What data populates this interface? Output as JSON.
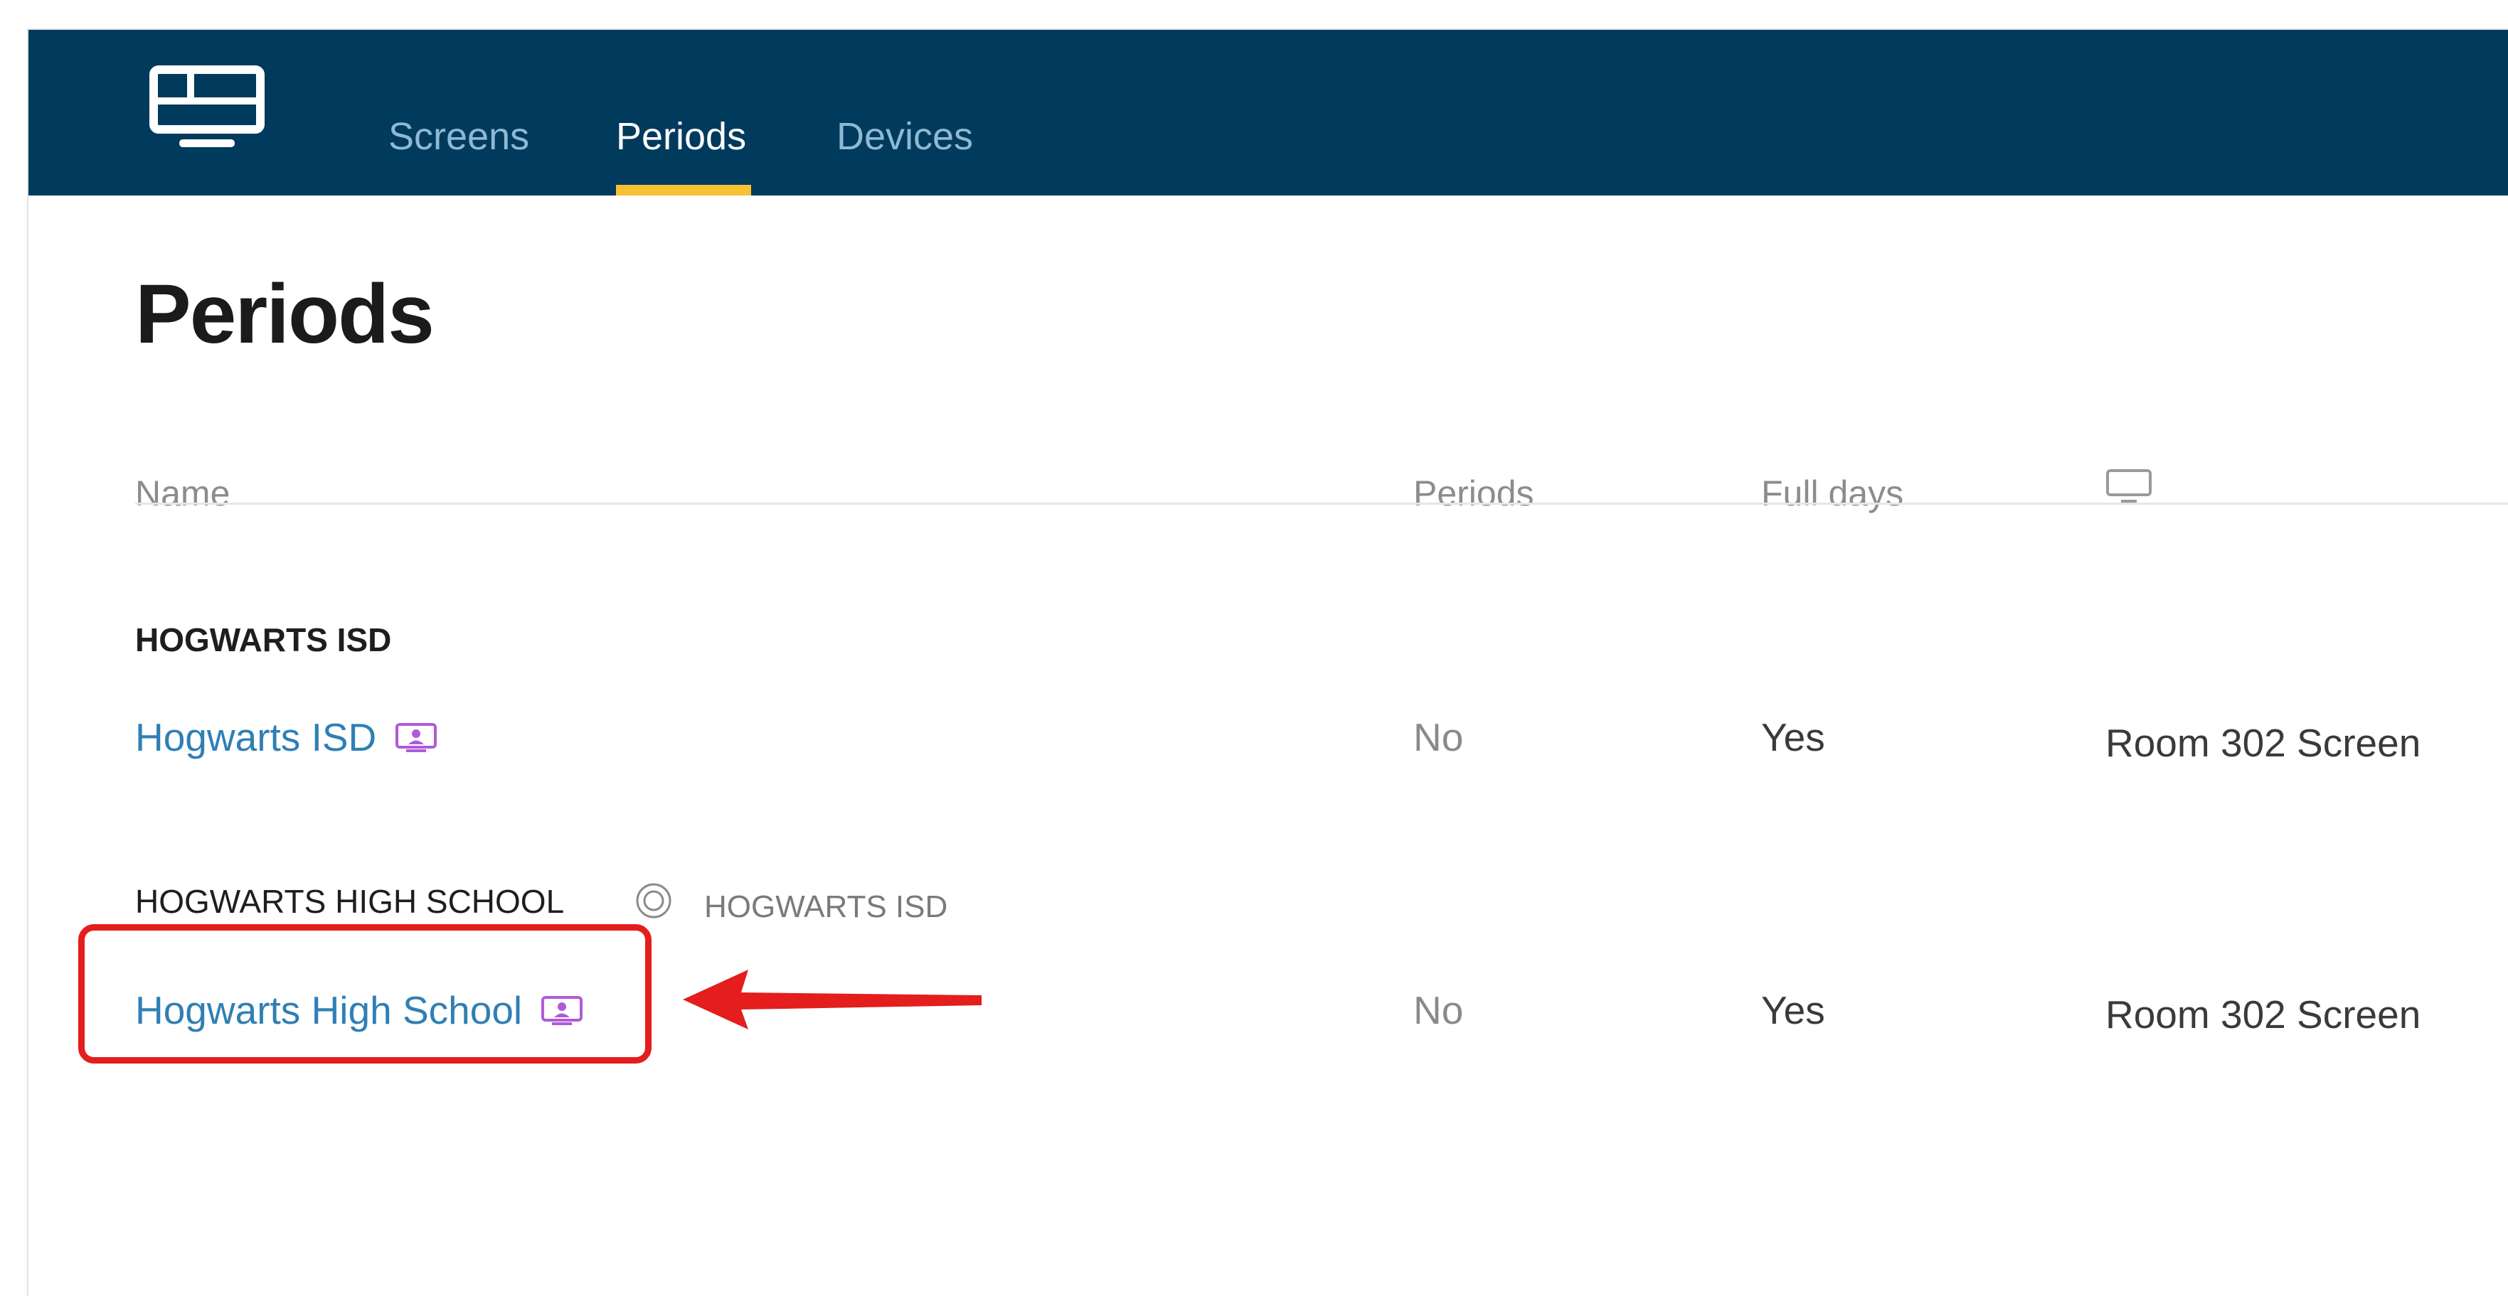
{
  "nav": {
    "logo_icon": "monitor-logo-icon",
    "tabs": [
      {
        "label": "Screens",
        "active": false
      },
      {
        "label": "Periods",
        "active": true
      },
      {
        "label": "Devices",
        "active": false
      }
    ],
    "active_underline_color": "#f6c234",
    "background_color": "#003a5c"
  },
  "page": {
    "title": "Periods"
  },
  "table": {
    "headers": {
      "name": "Name",
      "periods": "Periods",
      "full_days": "Full days",
      "screen_icon": "monitor-icon"
    },
    "groups": [
      {
        "title": "HOGWARTS ISD",
        "parent_icon": null,
        "parent": null,
        "rows": [
          {
            "name": "Hogwarts ISD",
            "icon": "screen-person-icon",
            "periods": "No",
            "full_days": "Yes",
            "screen": "Room 302 Screen"
          }
        ]
      },
      {
        "title": "HOGWARTS HIGH SCHOOL",
        "parent_icon": "target-circle-icon",
        "parent": "HOGWARTS ISD",
        "rows": [
          {
            "name": "Hogwarts High School",
            "icon": "screen-person-icon",
            "periods": "No",
            "full_days": "Yes",
            "screen": "Room 302 Screen"
          }
        ]
      }
    ]
  },
  "annotation": {
    "highlight_color": "#e41d1d",
    "target": "Hogwarts High School",
    "type": "red-box-with-arrow"
  }
}
